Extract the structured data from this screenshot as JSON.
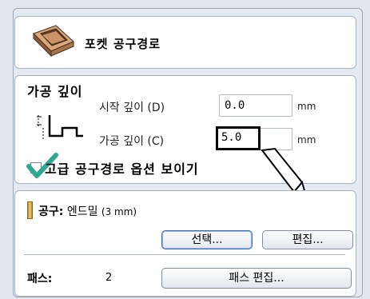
{
  "panel_title": "포켓 공구경로",
  "depth": {
    "heading": "가공 깊이",
    "start_depth_label": "시작 깊이 (D)",
    "start_depth_value": "0.0",
    "cut_depth_label": "가공 깊이 (C)",
    "cut_depth_value": "5.0",
    "unit": "mm",
    "advanced_checkbox_label": "고급 공구경로 옵션 보이기",
    "advanced_checked": true
  },
  "tool": {
    "label": "공구:",
    "name": "엔드밀",
    "size": "(3 mm)",
    "select_button": "선택...",
    "edit_button": "편집..."
  },
  "passes": {
    "label": "패스:",
    "value": "2",
    "edit_button": "패스 편집..."
  },
  "colors": {
    "background": "#dfe6f0",
    "panel": "#ffffff",
    "check_green": "#2fa890"
  }
}
